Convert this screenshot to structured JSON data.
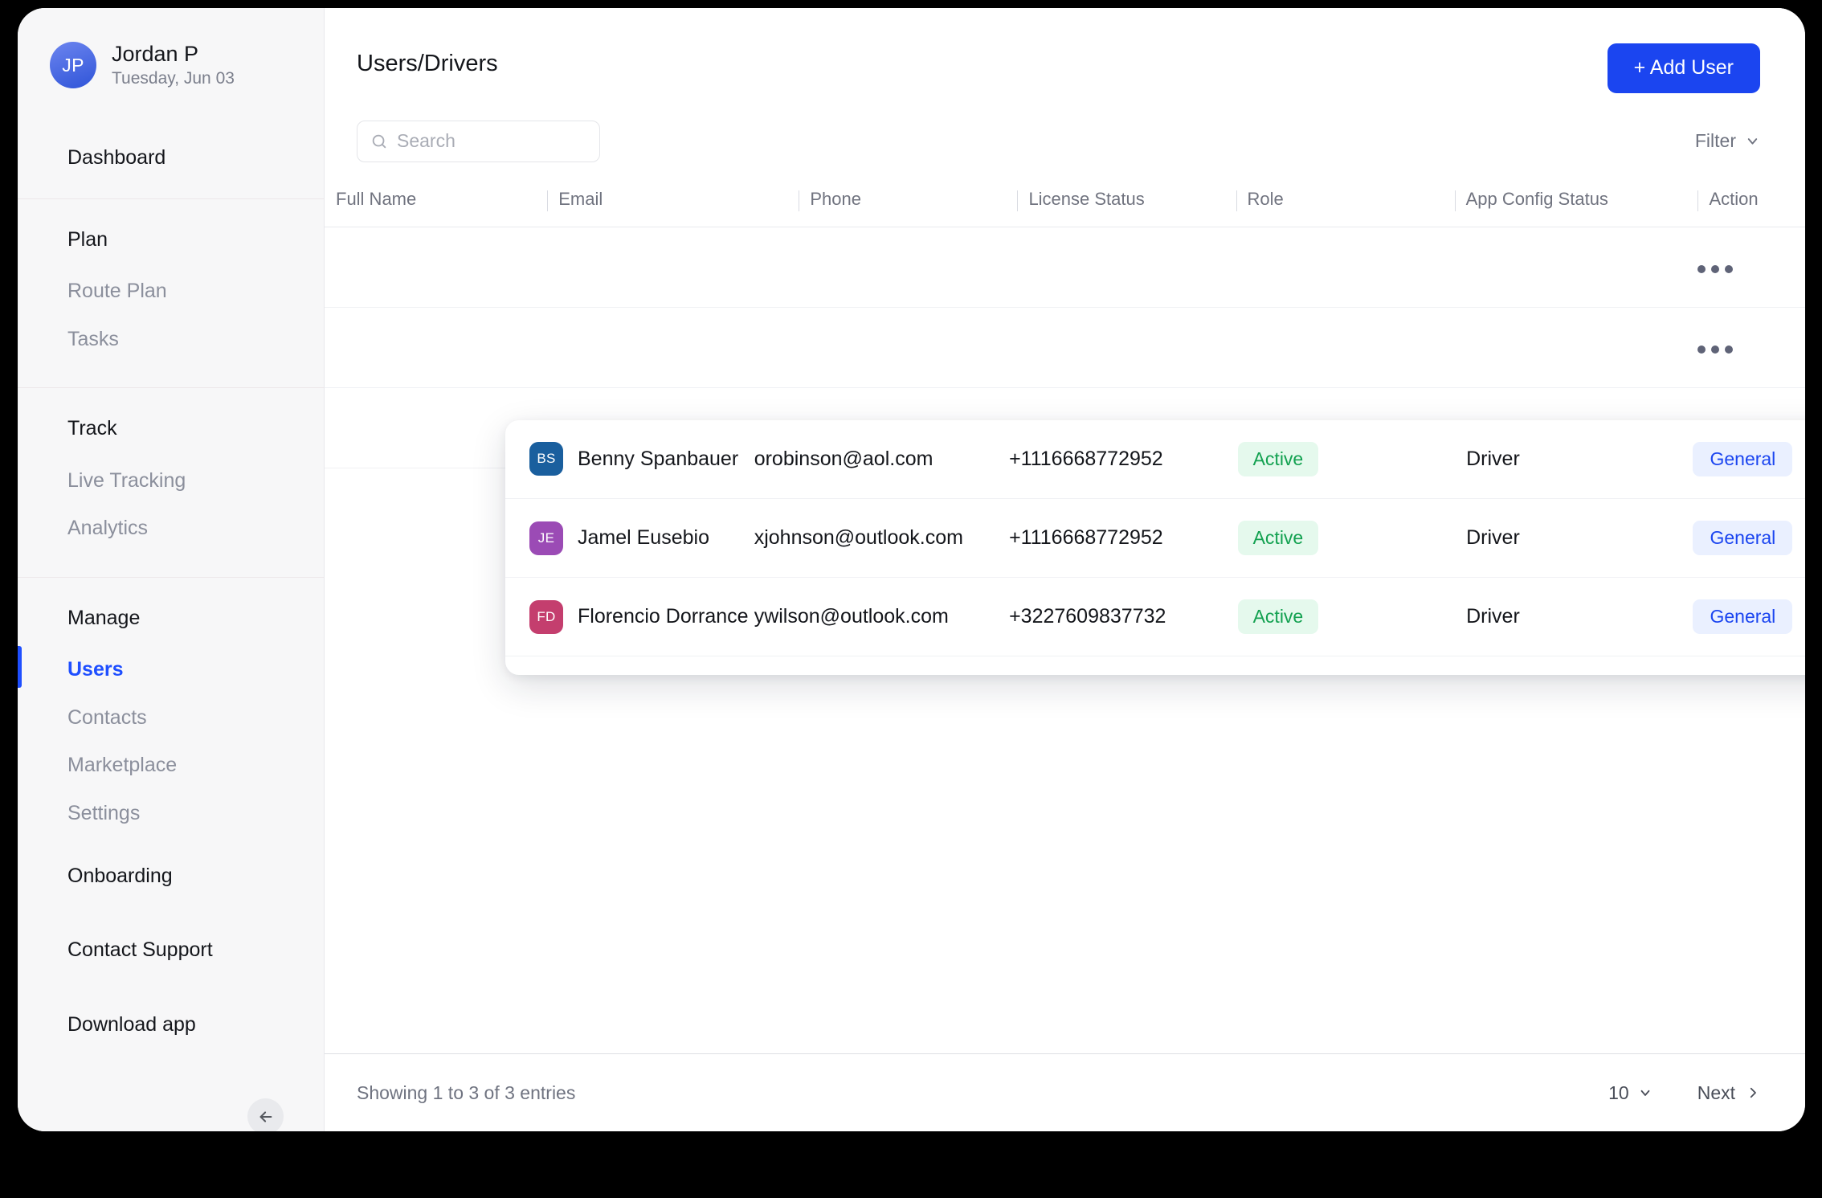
{
  "sidebar": {
    "profile": {
      "initials": "JP",
      "name": "Jordan P",
      "date": "Tuesday, Jun 03"
    },
    "dashboard_label": "Dashboard",
    "groups": [
      {
        "title": "Plan",
        "items": [
          {
            "label": "Route Plan"
          },
          {
            "label": "Tasks"
          }
        ]
      },
      {
        "title": "Track",
        "items": [
          {
            "label": "Live Tracking"
          },
          {
            "label": "Analytics"
          }
        ]
      },
      {
        "title": "Manage",
        "items": [
          {
            "label": "Users"
          },
          {
            "label": "Contacts"
          },
          {
            "label": "Marketplace"
          },
          {
            "label": "Settings"
          }
        ]
      }
    ],
    "bottom_items": [
      {
        "label": "Onboarding"
      },
      {
        "label": "Contact Support"
      },
      {
        "label": "Download app"
      }
    ],
    "collapse_icon": "arrow-left-icon",
    "active_item": "Users",
    "accent_color": "#1f4fff"
  },
  "header": {
    "title": "Users/Drivers",
    "add_user_label": "+ Add User",
    "add_user_color": "#1b45f0"
  },
  "toolbar": {
    "search_placeholder": "Search",
    "search_value": "",
    "search_icon": "search-icon",
    "filter_label": "Filter",
    "filter_icon": "chevron-down-icon"
  },
  "table": {
    "columns": [
      {
        "label": "Full Name"
      },
      {
        "label": "Email"
      },
      {
        "label": "Phone"
      },
      {
        "label": "License Status"
      },
      {
        "label": "Role"
      },
      {
        "label": "App Config Status"
      },
      {
        "label": "Action"
      }
    ],
    "rows": [
      {
        "initials": "BS",
        "avatar_color": "#1a5f9e",
        "full_name": "Benny Spanbauer",
        "email": "orobinson@aol.com",
        "phone": "+1116668772952",
        "license_status": "Active",
        "role": "Driver",
        "app_config_status": "General",
        "action_icon": "more-horizontal-icon"
      },
      {
        "initials": "JE",
        "avatar_color": "#9b4bb5",
        "full_name": "Jamel Eusebio",
        "email": "xjohnson@outlook.com",
        "phone": "+1116668772952",
        "license_status": "Active",
        "role": "Driver",
        "app_config_status": "General",
        "action_icon": "more-horizontal-icon"
      },
      {
        "initials": "FD",
        "avatar_color": "#c43e6e",
        "full_name": "Florencio Dorrance",
        "email": "ywilson@outlook.com",
        "phone": "+3227609837732",
        "license_status": "Active",
        "role": "Driver",
        "app_config_status": "General",
        "action_icon": "more-horizontal-icon"
      }
    ],
    "status_active_color": "#12a150",
    "status_active_bg": "#e5f9ed",
    "config_badge_color": "#1b45f0",
    "config_badge_bg": "#eaf0ff"
  },
  "footer": {
    "entries_text": "Showing 1 to 3 of 3 entries",
    "per_page": "10",
    "per_page_icon": "chevron-down-icon",
    "next_label": "Next",
    "next_icon": "chevron-right-icon"
  }
}
